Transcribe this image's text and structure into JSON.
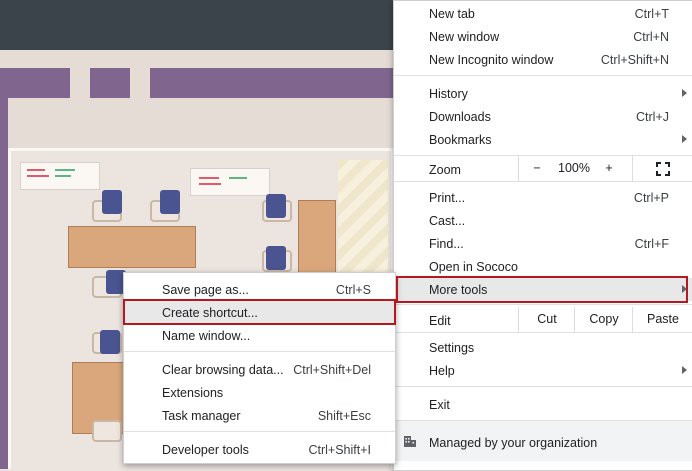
{
  "main_menu": {
    "new_tab": {
      "label": "New tab",
      "shortcut": "Ctrl+T"
    },
    "new_window": {
      "label": "New window",
      "shortcut": "Ctrl+N"
    },
    "new_incognito": {
      "label": "New Incognito window",
      "shortcut": "Ctrl+Shift+N"
    },
    "history": {
      "label": "History"
    },
    "downloads": {
      "label": "Downloads",
      "shortcut": "Ctrl+J"
    },
    "bookmarks": {
      "label": "Bookmarks"
    },
    "zoom": {
      "label": "Zoom",
      "minus": "−",
      "level": "100%",
      "plus": "+"
    },
    "print": {
      "label": "Print...",
      "shortcut": "Ctrl+P"
    },
    "cast": {
      "label": "Cast..."
    },
    "find": {
      "label": "Find...",
      "shortcut": "Ctrl+F"
    },
    "open_in_app": {
      "label": "Open in Sococo"
    },
    "more_tools": {
      "label": "More tools"
    },
    "edit": {
      "label": "Edit",
      "cut": "Cut",
      "copy": "Copy",
      "paste": "Paste"
    },
    "settings": {
      "label": "Settings"
    },
    "help": {
      "label": "Help"
    },
    "exit": {
      "label": "Exit"
    },
    "managed": {
      "label": "Managed by your organization"
    }
  },
  "more_tools_menu": {
    "save_page": {
      "label": "Save page as...",
      "shortcut": "Ctrl+S"
    },
    "create_shortcut": {
      "label": "Create shortcut..."
    },
    "name_window": {
      "label": "Name window..."
    },
    "clear_data": {
      "label": "Clear browsing data...",
      "shortcut": "Ctrl+Shift+Del"
    },
    "extensions": {
      "label": "Extensions"
    },
    "task_manager": {
      "label": "Task manager",
      "shortcut": "Shift+Esc"
    },
    "developer_tools": {
      "label": "Developer tools",
      "shortcut": "Ctrl+Shift+I"
    }
  },
  "colors": {
    "highlight_border": "#b3191f",
    "wall": "#80668e",
    "chair": "#4a5490"
  }
}
